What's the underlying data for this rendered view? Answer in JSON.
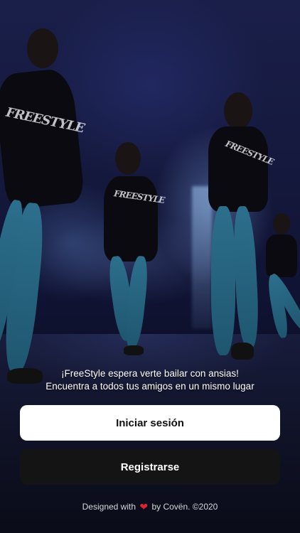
{
  "background": {
    "image": "dancers-on-stage-photo",
    "shirt_print": "FREESTYLE"
  },
  "tagline": {
    "line1": "¡FreeStyle  espera verte bailar con ansias!",
    "line2": "Encuentra a todos tus amigos en un mismo lugar"
  },
  "actions": {
    "login_label": "Iniciar sesión",
    "register_label": "Registrarse"
  },
  "footer": {
    "prefix": "Designed with",
    "heart": "❤",
    "suffix": "by Covën. ©2020"
  },
  "colors": {
    "login_bg": "#ffffff",
    "register_bg": "#141414",
    "heart": "#e0222e",
    "leggings": "#2c6f8c"
  }
}
